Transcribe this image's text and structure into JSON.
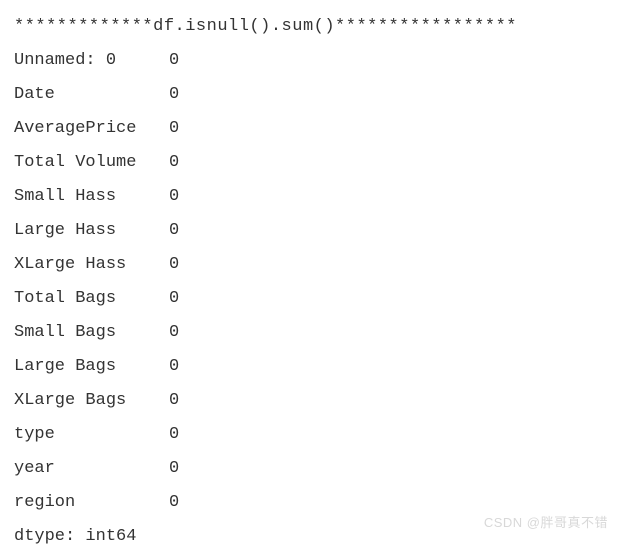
{
  "header": "*************df.isnull().sum()*****************",
  "rows": [
    {
      "label": "Unnamed: 0",
      "value": "0"
    },
    {
      "label": "Date",
      "value": "0"
    },
    {
      "label": "AveragePrice",
      "value": "0"
    },
    {
      "label": "Total Volume",
      "value": "0"
    },
    {
      "label": "Small Hass",
      "value": "0"
    },
    {
      "label": "Large Hass",
      "value": "0"
    },
    {
      "label": "XLarge Hass",
      "value": "0"
    },
    {
      "label": "Total Bags",
      "value": "0"
    },
    {
      "label": "Small Bags",
      "value": "0"
    },
    {
      "label": "Large Bags",
      "value": "0"
    },
    {
      "label": "XLarge Bags",
      "value": "0"
    },
    {
      "label": "type",
      "value": "0"
    },
    {
      "label": "year",
      "value": "0"
    },
    {
      "label": "region",
      "value": "0"
    }
  ],
  "dtype": "dtype: int64",
  "watermark": "CSDN @胖哥真不错"
}
